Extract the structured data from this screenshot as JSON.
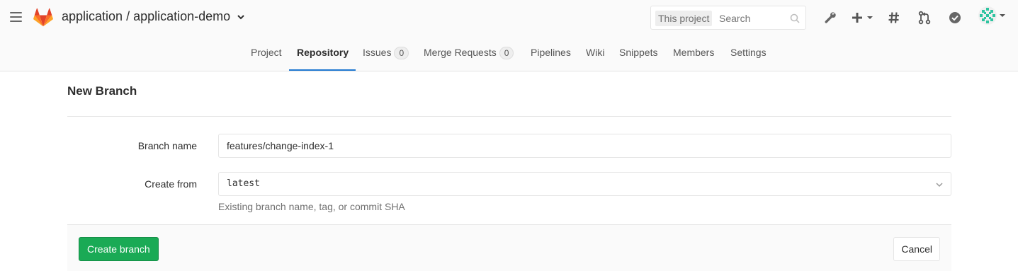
{
  "header": {
    "project_path": "application / application-demo",
    "search": {
      "scope": "This project",
      "placeholder": "Search"
    },
    "icons": [
      "wrench-icon",
      "plus-icon",
      "hash-icon",
      "merge-request-icon",
      "todo-check-icon",
      "avatar"
    ]
  },
  "nav": {
    "tabs": [
      {
        "label": "Project"
      },
      {
        "label": "Repository",
        "active": true
      },
      {
        "label": "Issues",
        "count": "0"
      },
      {
        "label": "Merge Requests",
        "count": "0"
      },
      {
        "label": "Pipelines"
      },
      {
        "label": "Wiki"
      },
      {
        "label": "Snippets"
      },
      {
        "label": "Members"
      },
      {
        "label": "Settings"
      }
    ]
  },
  "form": {
    "title": "New Branch",
    "branch_name_label": "Branch name",
    "branch_name_value": "features/change-index-1",
    "create_from_label": "Create from",
    "create_from_value": "latest",
    "create_from_help": "Existing branch name, tag, or commit SHA",
    "submit_label": "Create branch",
    "cancel_label": "Cancel"
  },
  "colors": {
    "accent_blue": "#1f78d1",
    "success_green": "#1aaa55",
    "gitlab_orange": "#e24329"
  }
}
